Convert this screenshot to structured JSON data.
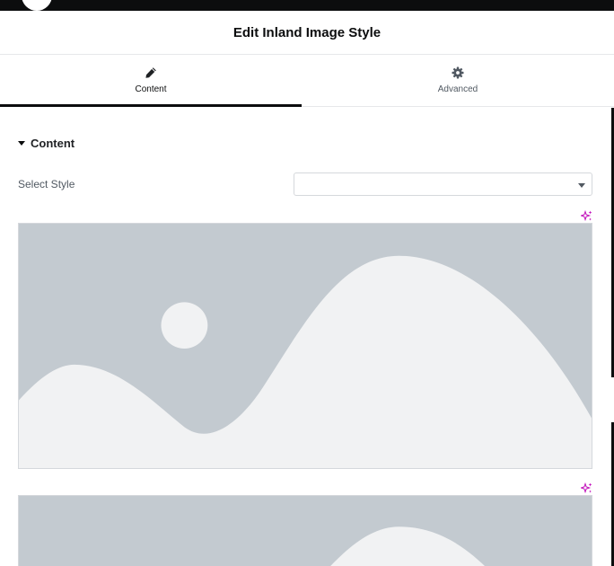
{
  "header": {
    "title": "Edit Inland Image Style"
  },
  "tabs": [
    {
      "label": "Content",
      "icon": "pencil-icon",
      "active": true
    },
    {
      "label": "Advanced",
      "icon": "gear-icon",
      "active": false
    }
  ],
  "section": {
    "title": "Content",
    "expanded": true
  },
  "select_style": {
    "label": "Select Style",
    "value": ""
  },
  "images": [
    {
      "icon": "image-placeholder-icon",
      "ai_icon": "ai-sparkle-icon"
    },
    {
      "icon": "image-placeholder-icon",
      "ai_icon": "ai-sparkle-icon"
    }
  ],
  "colors": {
    "placeholder_bg": "#c3cad0",
    "placeholder_fg": "#f1f2f3",
    "ai_accent": "#c00bb9",
    "active_tab": "#0c0d0e"
  }
}
